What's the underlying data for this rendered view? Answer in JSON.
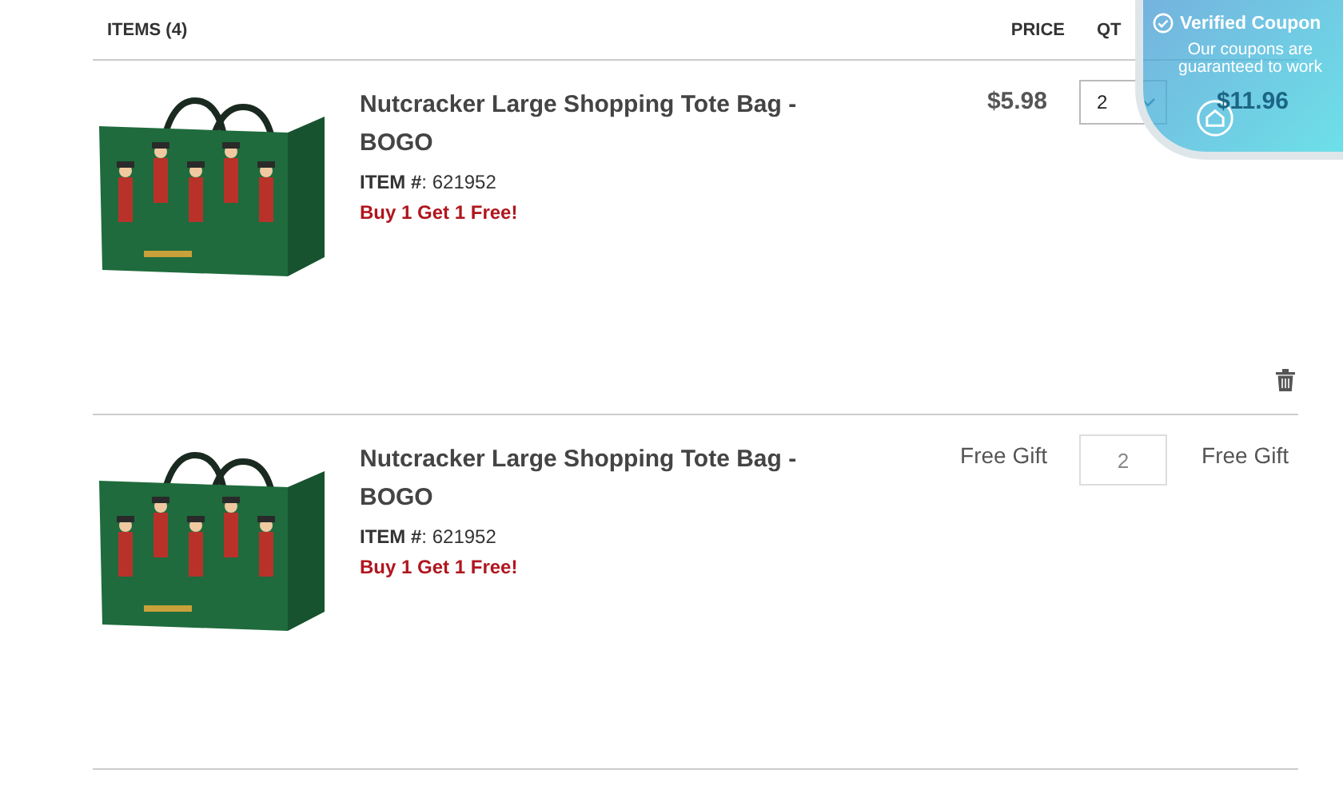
{
  "header": {
    "items": "ITEMS (4)",
    "price": "PRICE",
    "qty": "QT"
  },
  "items": [
    {
      "name": "Nutcracker Large Shopping Tote Bag - BOGO",
      "item_number": "**ITEM #**: 621952",
      "promo": "Buy 1 Get 1 Free!",
      "price": "$5.98",
      "qty": "2",
      "kind": "select",
      "subtotal": "$11.96",
      "removable": true
    },
    {
      "name": "Nutcracker Large Shopping Tote Bag - BOGO",
      "item_number": "**ITEM #**: 621952",
      "promo": "Buy 1 Get 1 Free!",
      "price": "Free Gift",
      "qty": "2",
      "kind": "fixed",
      "subtotal": "Free Gift",
      "removable": false
    }
  ],
  "coupon_badge": {
    "title": "Verified Coupon",
    "text": "Our coupons are guaranteed to work"
  }
}
